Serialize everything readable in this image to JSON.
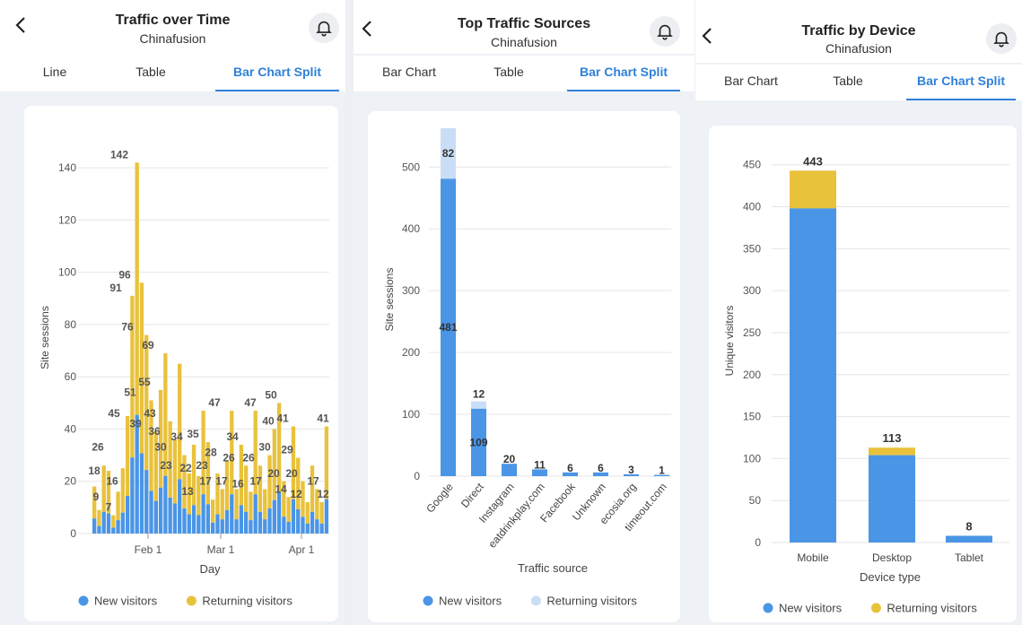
{
  "colors": {
    "accent": "#2f80d8",
    "new": "#4a95e6",
    "returning": "#e9c23c",
    "returning_light": "#c9def5"
  },
  "panels": [
    {
      "title": "Traffic over Time",
      "subtitle": "Chinafusion",
      "tabs": [
        "Line",
        "Table",
        "Bar Chart Split"
      ],
      "active_tab": 2
    },
    {
      "title": "Top Traffic Sources",
      "subtitle": "Chinafusion",
      "tabs": [
        "Bar Chart",
        "Table",
        "Bar Chart Split"
      ],
      "active_tab": 2
    },
    {
      "title": "Traffic by Device",
      "subtitle": "Chinafusion",
      "tabs": [
        "Bar Chart",
        "Table",
        "Bar Chart Split"
      ],
      "active_tab": 2
    }
  ],
  "chart_data": [
    {
      "type": "bar",
      "stacked": true,
      "xlabel": "Day",
      "ylabel": "Site sessions",
      "ylim": [
        0,
        150
      ],
      "yticks": [
        0,
        20,
        40,
        60,
        80,
        100,
        120,
        140
      ],
      "xticks": [
        "Feb 1",
        "Mar 1",
        "Apr 1"
      ],
      "legend": [
        "New visitors",
        "Returning visitors"
      ],
      "legend_position": "bottom",
      "annotations": [
        "18",
        "26",
        "9",
        "7",
        "16",
        "45",
        "91",
        "142",
        "96",
        "76",
        "51",
        "39",
        "55",
        "69",
        "43",
        "36",
        "30",
        "23",
        "34",
        "22",
        "35",
        "13",
        "23",
        "17",
        "28",
        "47",
        "17",
        "34",
        "26",
        "16",
        "47",
        "26",
        "17",
        "30",
        "40",
        "50",
        "20",
        "14",
        "41",
        "29",
        "20",
        "12",
        "17",
        "41",
        "12"
      ],
      "sample_daily_totals": [
        18,
        9,
        26,
        24,
        7,
        16,
        25,
        45,
        91,
        142,
        96,
        76,
        51,
        39,
        55,
        69,
        43,
        36,
        65,
        30,
        23,
        34,
        22,
        47,
        35,
        13,
        23,
        17,
        28,
        47,
        17,
        34,
        26,
        16,
        47,
        26,
        17,
        30,
        40,
        50,
        20,
        14,
        41,
        29,
        20,
        12,
        26,
        17,
        12,
        41
      ]
    },
    {
      "type": "bar",
      "stacked": true,
      "xlabel": "Traffic source",
      "ylabel": "Site sessions",
      "ylim": [
        0,
        570
      ],
      "yticks": [
        0,
        100,
        200,
        300,
        400,
        500
      ],
      "categories": [
        "Google",
        "Direct",
        "Instagram",
        "eatdrinkplay.com",
        "Facebook",
        "Unknown",
        "ecosia.org",
        "timeout.com"
      ],
      "series": [
        {
          "name": "New visitors",
          "values": [
            481,
            109,
            20,
            11,
            6,
            6,
            3,
            1
          ]
        },
        {
          "name": "Returning visitors",
          "values": [
            82,
            12,
            0,
            0,
            0,
            0,
            0,
            0
          ]
        }
      ],
      "labels_new": [
        "481",
        "109",
        "20",
        "11",
        "6",
        "6",
        "3",
        "1"
      ],
      "labels_returning": [
        "82",
        "12",
        "",
        "",
        "",
        "",
        "",
        ""
      ],
      "legend_position": "bottom"
    },
    {
      "type": "bar",
      "stacked": true,
      "xlabel": "Device type",
      "ylabel": "Unique visitors",
      "ylim": [
        0,
        470
      ],
      "yticks": [
        0,
        50,
        100,
        150,
        200,
        250,
        300,
        350,
        400,
        450
      ],
      "categories": [
        "Mobile",
        "Desktop",
        "Tablet"
      ],
      "series": [
        {
          "name": "New visitors",
          "values": [
            398,
            104,
            8
          ]
        },
        {
          "name": "Returning visitors",
          "values": [
            45,
            9,
            0
          ]
        }
      ],
      "totals": [
        "443",
        "113",
        "8"
      ],
      "legend_position": "bottom"
    }
  ]
}
